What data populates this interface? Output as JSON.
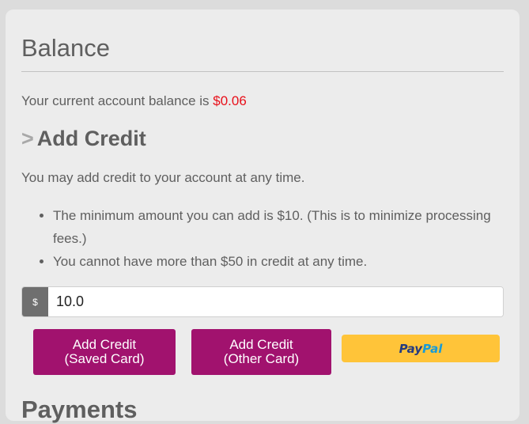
{
  "page": {
    "title": "Balance",
    "balance_text": "Your current account balance is ",
    "balance_amount": "$0.06",
    "balance_color": "#e8101a"
  },
  "add_credit": {
    "chevron": ">",
    "heading": "Add Credit",
    "intro": "You may add credit to your account at any time.",
    "rules": [
      "The minimum amount you can add is $10. (This is to minimize processing fees.)",
      "You cannot have more than $50 in credit at any time."
    ],
    "currency_symbol": "$",
    "amount_value": "10.0",
    "saved_card_button": {
      "line1": "Add Credit",
      "line2": "(Saved Card)"
    },
    "other_card_button": {
      "line1": "Add Credit",
      "line2": "(Other Card)"
    },
    "paypal": {
      "pay": "Pay",
      "pal": "Pal"
    },
    "button_color": "#a1126e",
    "paypal_color": "#ffc439"
  },
  "next_section": {
    "heading": "Payments"
  }
}
